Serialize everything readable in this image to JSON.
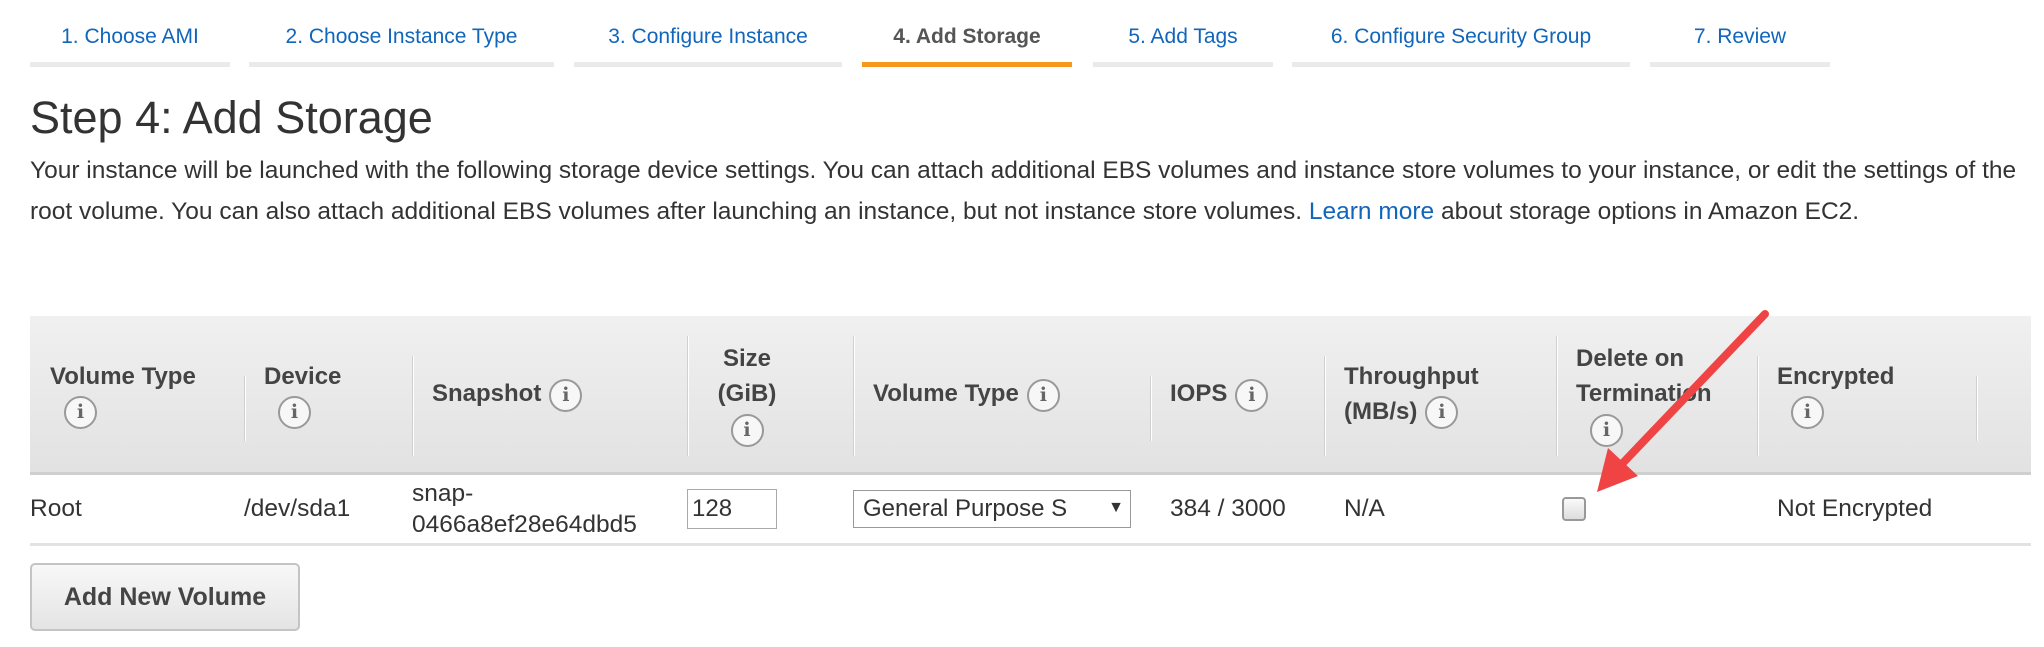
{
  "tabs": [
    "1. Choose AMI",
    "2. Choose Instance Type",
    "3. Configure Instance",
    "4. Add Storage",
    "5. Add Tags",
    "6. Configure Security Group",
    "7. Review"
  ],
  "active_tab": 3,
  "title": "Step 4: Add Storage",
  "description": {
    "before": "Your instance will be launched with the following storage device settings. You can attach additional EBS volumes and instance store volumes to your instance, or edit the settings of the root volume. You can also attach additional EBS volumes after launching an instance, but not instance store volumes. ",
    "link": "Learn more",
    "after": " about storage options in Amazon EC2."
  },
  "table": {
    "headers": [
      "Volume Type",
      "Device",
      "Snapshot",
      "Size (GiB)",
      "Volume Type",
      "IOPS",
      "Throughput (MB/s)",
      "Delete on Termination",
      "Encrypted"
    ],
    "info_icon": "i",
    "row": {
      "volume_type": "Root",
      "device": "/dev/sda1",
      "snapshot_1": "snap-",
      "snapshot_2": "0466a8ef28e64dbd5",
      "size": "128",
      "ebs_type": "General Purpose S",
      "iops": "384 / 3000",
      "throughput": "N/A",
      "delete_on_termination": false,
      "encrypted": "Not Encrypted"
    }
  },
  "add_button": "Add New Volume",
  "colors": {
    "link": "#1166bb",
    "active_tab": "#f7981d",
    "arrow": "#f04040"
  }
}
